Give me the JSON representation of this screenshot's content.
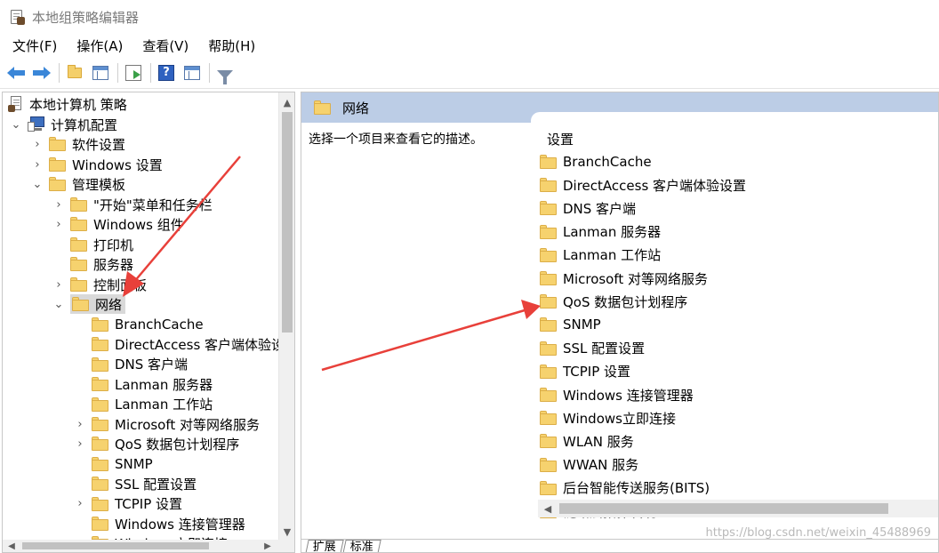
{
  "window": {
    "title": "本地组策略编辑器"
  },
  "menu": [
    "文件(F)",
    "操作(A)",
    "查看(V)",
    "帮助(H)"
  ],
  "tree": {
    "root": "本地计算机 策略",
    "computer_config": "计算机配置",
    "software_settings": "软件设置",
    "windows_settings": "Windows 设置",
    "admin_templates": "管理模板",
    "start_menu": "\"开始\"菜单和任务栏",
    "windows_components": "Windows 组件",
    "printers": "打印机",
    "servers": "服务器",
    "control_panel": "控制面板",
    "network": "网络",
    "network_children": [
      "BranchCache",
      "DirectAccess 客户端体验设置",
      "DNS 客户端",
      "Lanman 服务器",
      "Lanman 工作站",
      "Microsoft 对等网络服务",
      "QoS 数据包计划程序",
      "SNMP",
      "SSL 配置设置",
      "TCPIP 设置",
      "Windows 连接管理器",
      "Windows立即连接"
    ]
  },
  "right": {
    "header": "网络",
    "description": "选择一个项目来查看它的描述。",
    "column": "设置",
    "items": [
      "BranchCache",
      "DirectAccess 客户端体验设置",
      "DNS 客户端",
      "Lanman 服务器",
      "Lanman 工作站",
      "Microsoft 对等网络服务",
      "QoS 数据包计划程序",
      "SNMP",
      "SSL 配置设置",
      "TCPIP 设置",
      "Windows 连接管理器",
      "Windows立即连接",
      "WLAN 服务",
      "WWAN 服务",
      "后台智能传送服务(BITS)",
      "链路层拓扑发现"
    ]
  },
  "tabs": [
    "扩展",
    "标准"
  ],
  "watermark": "https://blog.csdn.net/weixin_45488969",
  "colors": {
    "header_bg": "#bccde6",
    "selection_bg": "#d9d9d9",
    "annotation_arrow": "#e8403a",
    "folder": "#f6d26e"
  }
}
